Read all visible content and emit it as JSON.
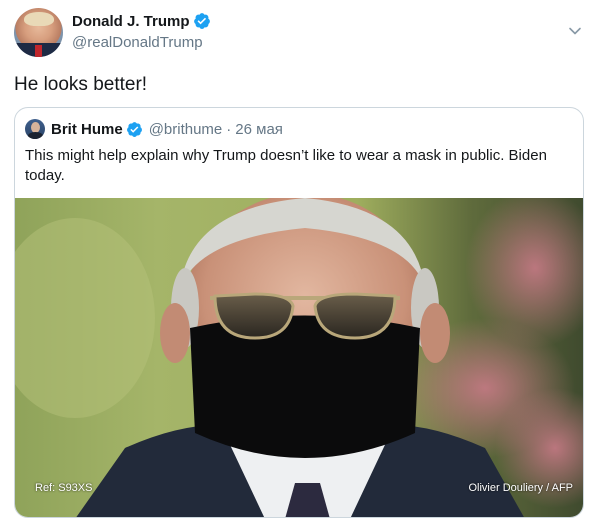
{
  "author": {
    "name": "Donald J. Trump",
    "handle": "@realDonaldTrump",
    "verified": true,
    "avatar_icon": "profile-photo"
  },
  "menu": {
    "icon": "chevron-down-icon"
  },
  "tweet": {
    "text": "He looks better!"
  },
  "quoted": {
    "name": "Brit Hume",
    "handle": "@brithume",
    "separator": "·",
    "date": "26 мая",
    "verified": true,
    "text": "This might help explain why Trump doesn’t like to wear a mask in public. Biden today.",
    "media": {
      "caption_left": "Ref: S93XS",
      "caption_right": "Olivier Douliery / AFP"
    }
  },
  "colors": {
    "verified_blue": "#1da1f2",
    "secondary_text": "#657786",
    "border": "#ccd6dd"
  }
}
